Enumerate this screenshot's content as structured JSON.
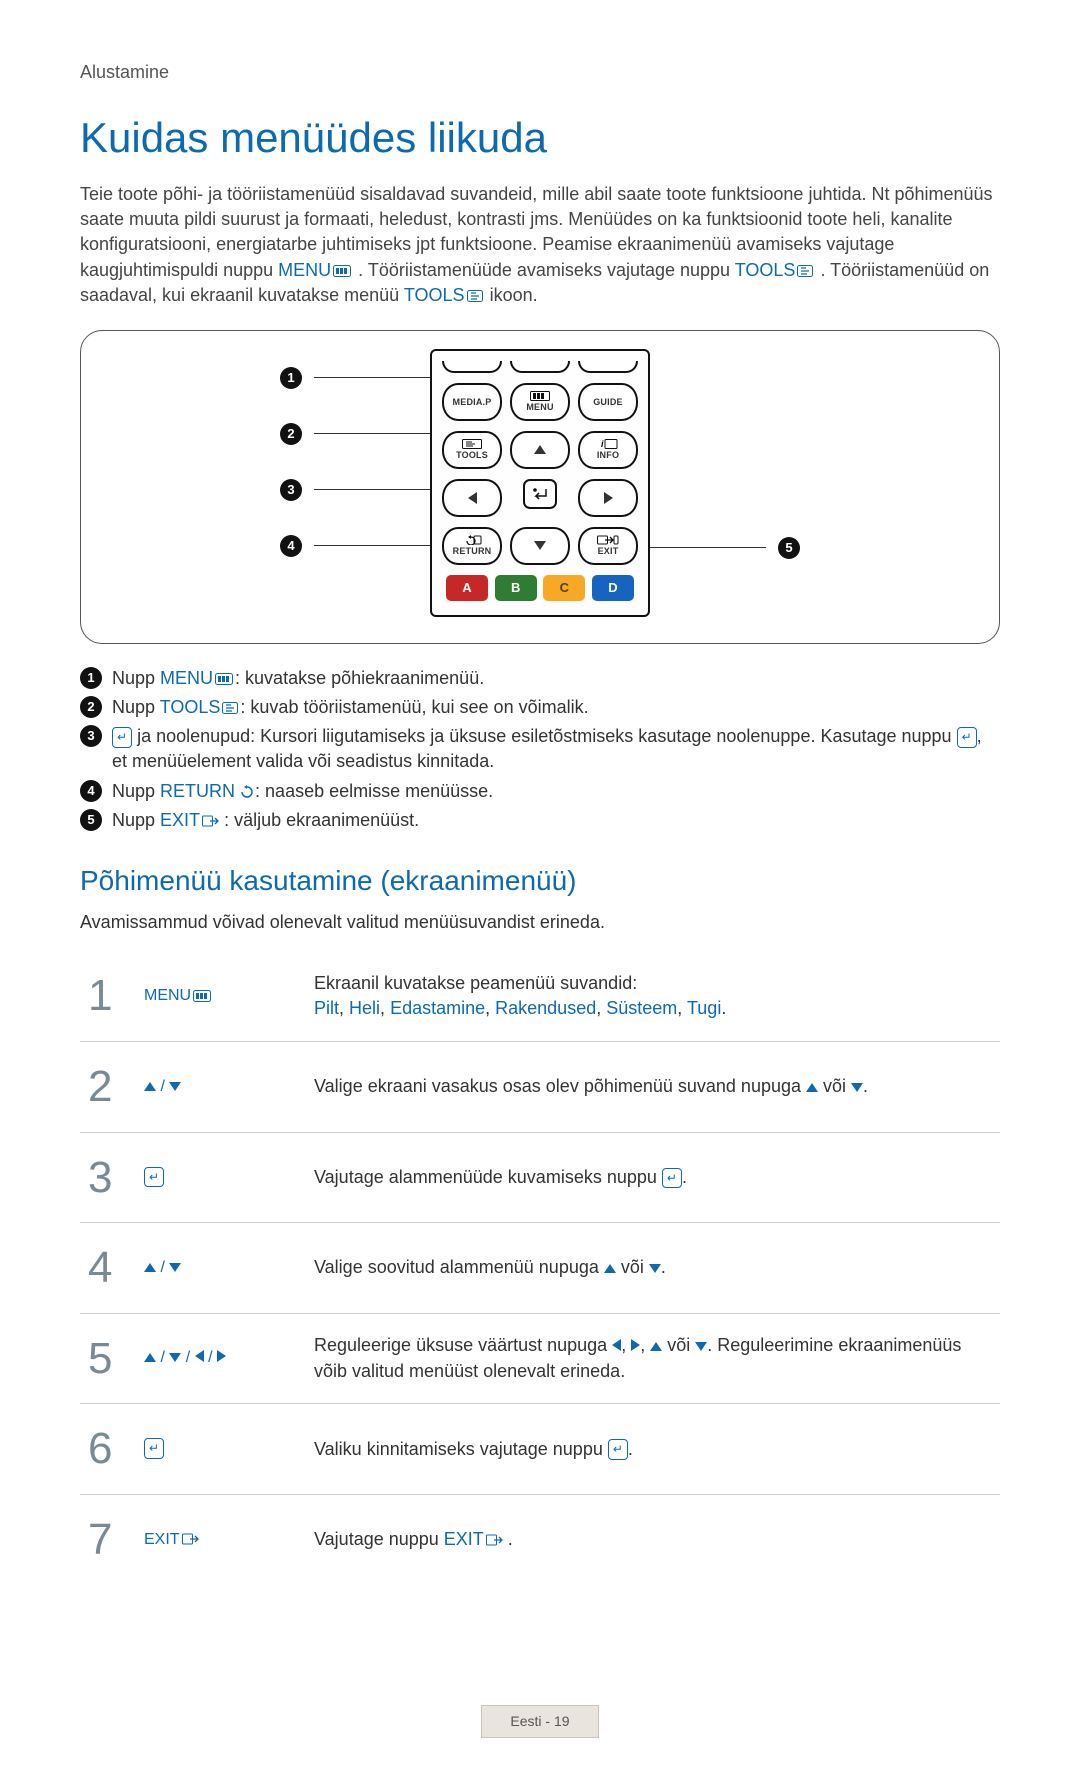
{
  "breadcrumb": "Alustamine",
  "title": "Kuidas menüüdes liikuda",
  "intro_parts": {
    "p1": "Teie toote põhi- ja tööriistamenüüd sisaldavad suvandeid, mille abil saate toote funktsioone juhtida. Nt põhimenüüs saate muuta pildi suurust ja formaati, heledust, kontrasti jms. Menüüdes on ka funktsioonid toote heli, kanalite konfiguratsiooni, energiatarbe juhtimiseks jpt funktsioone. Peamise ekraanimenüü avamiseks vajutage kaugjuhtimispuldi nuppu ",
    "menu": "MENU",
    "p2": ". Tööriistamenüüde avamiseks vajutage nuppu ",
    "tools": "TOOLS",
    "p3": ". Tööriistamenüüd on saadaval, kui ekraanil kuvatakse menüü ",
    "tools2": "TOOLS",
    "p4": " ikoon."
  },
  "remote": {
    "row1": {
      "mediap": "MEDIA.P",
      "menu": "MENU",
      "guide": "GUIDE"
    },
    "row2": {
      "tools": "TOOLS",
      "info": "INFO"
    },
    "row4": {
      "return": "RETURN",
      "exit": "EXIT"
    },
    "colors": {
      "a": "A",
      "b": "B",
      "c": "C",
      "d": "D"
    }
  },
  "callouts": {
    "c1": "1",
    "c2": "2",
    "c3": "3",
    "c4": "4",
    "c5": "5"
  },
  "legend": {
    "l1a": "Nupp ",
    "l1b": "MENU",
    "l1c": ": kuvatakse põhiekraanimenüü.",
    "l2a": "Nupp ",
    "l2b": "TOOLS",
    "l2c": ": kuvab tööriistamenüü, kui see on võimalik.",
    "l3a": " ja noolenupud: Kursori liigutamiseks ja üksuse esiletõstmiseks kasutage noolenuppe. Kasutage nuppu ",
    "l3b": ", et menüüelement valida või seadistus kinnitada.",
    "l4a": "Nupp ",
    "l4b": "RETURN",
    "l4c": ": naaseb eelmisse menüüsse.",
    "l5a": "Nupp ",
    "l5b": "EXIT",
    "l5c": ": väljub ekraanimenüüst."
  },
  "section2_title": "Põhimenüü kasutamine (ekraanimenüü)",
  "section2_desc": "Avamissammud võivad olenevalt valitud menüüsuvandist erineda.",
  "steps": {
    "s1": {
      "num": "1",
      "act": "MENU",
      "d1": "Ekraanil kuvatakse peamenüü suvandid:",
      "d2a": "Pilt",
      "d2b": "Heli",
      "d2c": "Edastamine",
      "d2d": "Rakendused",
      "d2e": "Süsteem",
      "d2f": "Tugi"
    },
    "s2": {
      "num": "2",
      "d1": "Valige ekraani vasakus osas olev põhimenüü suvand nupuga ",
      "d2": " või "
    },
    "s3": {
      "num": "3",
      "d1": "Vajutage alammenüüde kuvamiseks nuppu "
    },
    "s4": {
      "num": "4",
      "d1": "Valige soovitud alammenüü nupuga ",
      "d2": " või "
    },
    "s5": {
      "num": "5",
      "d1": "Reguleerige üksuse väärtust nupuga ",
      "d2": " või ",
      "d3": ". Reguleerimine ekraanimenüüs võib valitud menüüst olenevalt erineda."
    },
    "s6": {
      "num": "6",
      "d1": "Valiku kinnitamiseks vajutage nuppu "
    },
    "s7": {
      "num": "7",
      "act": "EXIT",
      "d1": "Vajutage nuppu ",
      "d2": "EXIT"
    }
  },
  "footer": {
    "lang": "Eesti",
    "sep": " - ",
    "page": "19"
  }
}
